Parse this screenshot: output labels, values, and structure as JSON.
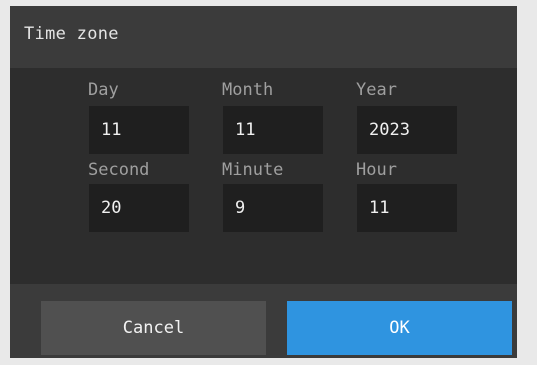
{
  "dialog": {
    "title": "Time zone"
  },
  "fields": {
    "day": {
      "label": "Day",
      "value": "11"
    },
    "month": {
      "label": "Month",
      "value": "11"
    },
    "year": {
      "label": "Year",
      "value": "2023"
    },
    "second": {
      "label": "Second",
      "value": "20"
    },
    "minute": {
      "label": "Minute",
      "value": "9"
    },
    "hour": {
      "label": "Hour",
      "value": "11"
    }
  },
  "buttons": {
    "cancel_label": "Cancel",
    "ok_label": "OK"
  },
  "colors": {
    "accent": "#2f94e0",
    "background": "#2d2d2d",
    "header": "#3b3b3b",
    "field": "#1f1f1f"
  }
}
